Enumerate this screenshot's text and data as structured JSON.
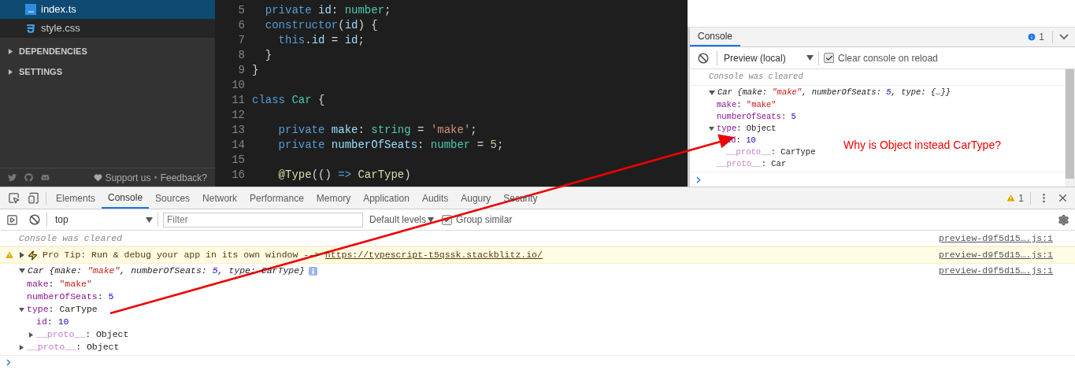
{
  "sidebar": {
    "files": [
      {
        "name": "index.ts",
        "kind": "ts",
        "selected": true
      },
      {
        "name": "style.css",
        "kind": "css",
        "selected": false
      }
    ],
    "sections": [
      {
        "label": "DEPENDENCIES",
        "expanded": false
      },
      {
        "label": "SETTINGS",
        "expanded": false
      }
    ],
    "footer": {
      "support": "Support us",
      "separator": "•",
      "feedback": "Feedback?"
    }
  },
  "editor": {
    "lines": [
      {
        "number": "5",
        "tokens": [
          {
            "text": "  private",
            "kind": "kw"
          },
          {
            "text": " id",
            "kind": "var"
          },
          {
            "text": ": ",
            "kind": "plain"
          },
          {
            "text": "number",
            "kind": "type"
          },
          {
            "text": ";",
            "kind": "plain"
          }
        ]
      },
      {
        "number": "6",
        "tokens": [
          {
            "text": "  constructor",
            "kind": "kw"
          },
          {
            "text": "(",
            "kind": "plain"
          },
          {
            "text": "id",
            "kind": "var"
          },
          {
            "text": ") {",
            "kind": "plain"
          }
        ]
      },
      {
        "number": "7",
        "tokens": [
          {
            "text": "    this",
            "kind": "kw"
          },
          {
            "text": ".",
            "kind": "plain"
          },
          {
            "text": "id",
            "kind": "var"
          },
          {
            "text": " = ",
            "kind": "plain"
          },
          {
            "text": "id",
            "kind": "var"
          },
          {
            "text": ";",
            "kind": "plain"
          }
        ]
      },
      {
        "number": "8",
        "tokens": [
          {
            "text": "  }",
            "kind": "plain"
          }
        ]
      },
      {
        "number": "9",
        "tokens": [
          {
            "text": "}",
            "kind": "plain"
          }
        ]
      },
      {
        "number": "10"
      },
      {
        "number": "11",
        "tokens": [
          {
            "text": "class",
            "kind": "kw"
          },
          {
            "text": " Car",
            "kind": "cls"
          },
          {
            "text": " {",
            "kind": "plain"
          }
        ]
      },
      {
        "number": "12"
      },
      {
        "number": "13",
        "tokens": [
          {
            "text": "    private",
            "kind": "kw"
          },
          {
            "text": " make",
            "kind": "var"
          },
          {
            "text": ": ",
            "kind": "plain"
          },
          {
            "text": "string",
            "kind": "type"
          },
          {
            "text": " = ",
            "kind": "plain"
          },
          {
            "text": "'make'",
            "kind": "str"
          },
          {
            "text": ";",
            "kind": "plain"
          }
        ]
      },
      {
        "number": "14",
        "tokens": [
          {
            "text": "    private",
            "kind": "kw"
          },
          {
            "text": " numberOfSeats",
            "kind": "var"
          },
          {
            "text": ": ",
            "kind": "plain"
          },
          {
            "text": "number",
            "kind": "type"
          },
          {
            "text": " = ",
            "kind": "plain"
          },
          {
            "text": "5",
            "kind": "num"
          },
          {
            "text": ";",
            "kind": "plain"
          }
        ]
      },
      {
        "number": "15"
      },
      {
        "number": "16",
        "tokens": [
          {
            "text": "    @Type",
            "kind": "fn"
          },
          {
            "text": "(() ",
            "kind": "plain"
          },
          {
            "text": "=>",
            "kind": "kw"
          },
          {
            "text": " CarType",
            "kind": "fn"
          },
          {
            "text": ")",
            "kind": "plain"
          }
        ]
      }
    ]
  },
  "preview_console": {
    "tab": {
      "label": "Console",
      "selected": true
    },
    "info_count": "1",
    "context": "Preview (local)",
    "clear_on_reload": {
      "label": "Clear console on reload",
      "checked": true
    },
    "messages": [
      {
        "kind": "cleared",
        "text": "Console was cleared"
      },
      {
        "kind": "object",
        "expanded": true,
        "tokens": [
          {
            "text": "Car {make: ",
            "kind": "plain"
          },
          {
            "text": "\"make\"",
            "kind": "string"
          },
          {
            "text": ", numberOfSeats: ",
            "kind": "plain"
          },
          {
            "text": "5",
            "kind": "number"
          },
          {
            "text": ", type: {…}}",
            "kind": "plain"
          }
        ],
        "children": [
          {
            "tokens": [
              {
                "text": "make",
                "kind": "key"
              },
              {
                "text": ": ",
                "kind": "plain"
              },
              {
                "text": "\"make\"",
                "kind": "string"
              }
            ]
          },
          {
            "tokens": [
              {
                "text": "numberOfSeats",
                "kind": "key"
              },
              {
                "text": ": ",
                "kind": "plain"
              },
              {
                "text": "5",
                "kind": "number"
              }
            ]
          },
          {
            "expanded": true,
            "tokens": [
              {
                "text": "type",
                "kind": "key"
              },
              {
                "text": ": Object",
                "kind": "plain"
              }
            ],
            "children": [
              {
                "tokens": [
                  {
                    "text": "id",
                    "kind": "key"
                  },
                  {
                    "text": ": ",
                    "kind": "plain"
                  },
                  {
                    "text": "10",
                    "kind": "number"
                  }
                ]
              },
              {
                "tokens": [
                  {
                    "text": "__proto__",
                    "kind": "proto"
                  },
                  {
                    "text": ": CarType",
                    "kind": "plain"
                  }
                ]
              }
            ]
          },
          {
            "tokens": [
              {
                "text": "__proto__",
                "kind": "proto"
              },
              {
                "text": ": Car",
                "kind": "plain"
              }
            ]
          }
        ]
      }
    ]
  },
  "devtools": {
    "tabs": [
      {
        "label": "Elements",
        "selected": false
      },
      {
        "label": "Console",
        "selected": true
      },
      {
        "label": "Sources",
        "selected": false
      },
      {
        "label": "Network",
        "selected": false
      },
      {
        "label": "Performance",
        "selected": false
      },
      {
        "label": "Memory",
        "selected": false
      },
      {
        "label": "Application",
        "selected": false
      },
      {
        "label": "Audits",
        "selected": false
      },
      {
        "label": "Augury",
        "selected": false
      },
      {
        "label": "Security",
        "selected": false
      }
    ],
    "warning_count": "1",
    "context": "top",
    "filter": {
      "placeholder": "Filter"
    },
    "levels": "Default levels",
    "group_similar": {
      "label": "Group similar",
      "checked": true
    },
    "messages": [
      {
        "kind": "cleared",
        "text": "Console was cleared",
        "source": "preview-d9f5d15….js:1"
      },
      {
        "kind": "warning",
        "expanded": false,
        "text": "Pro Tip: Run & debug your app in its own window --> ",
        "link": "https://typescript-t5qssk.stackblitz.io/",
        "source": "preview-d9f5d15….js:1"
      },
      {
        "kind": "object",
        "expanded": true,
        "info_badge": true,
        "source": "preview-d9f5d15….js:1",
        "tokens": [
          {
            "text": "Car {make: ",
            "kind": "plain"
          },
          {
            "text": "\"make\"",
            "kind": "string"
          },
          {
            "text": ", numberOfSeats: ",
            "kind": "plain"
          },
          {
            "text": "5",
            "kind": "number"
          },
          {
            "text": ", type: CarType}",
            "kind": "plain"
          }
        ],
        "children": [
          {
            "tokens": [
              {
                "text": "make",
                "kind": "key"
              },
              {
                "text": ": ",
                "kind": "plain"
              },
              {
                "text": "\"make\"",
                "kind": "string"
              }
            ]
          },
          {
            "tokens": [
              {
                "text": "numberOfSeats",
                "kind": "key"
              },
              {
                "text": ": ",
                "kind": "plain"
              },
              {
                "text": "5",
                "kind": "number"
              }
            ]
          },
          {
            "expanded": true,
            "tokens": [
              {
                "text": "type",
                "kind": "key"
              },
              {
                "text": ": CarType",
                "kind": "plain"
              }
            ],
            "children": [
              {
                "tokens": [
                  {
                    "text": "id",
                    "kind": "key"
                  },
                  {
                    "text": ": ",
                    "kind": "plain"
                  },
                  {
                    "text": "10",
                    "kind": "number"
                  }
                ]
              },
              {
                "expanded": false,
                "tokens": [
                  {
                    "text": "__proto__",
                    "kind": "proto"
                  },
                  {
                    "text": ": Object",
                    "kind": "plain"
                  }
                ]
              }
            ]
          },
          {
            "expanded": false,
            "tokens": [
              {
                "text": "__proto__",
                "kind": "proto"
              },
              {
                "text": ": Object",
                "kind": "plain"
              }
            ]
          }
        ]
      }
    ]
  },
  "annotation": {
    "text": "Why is Object instead CarType?"
  }
}
